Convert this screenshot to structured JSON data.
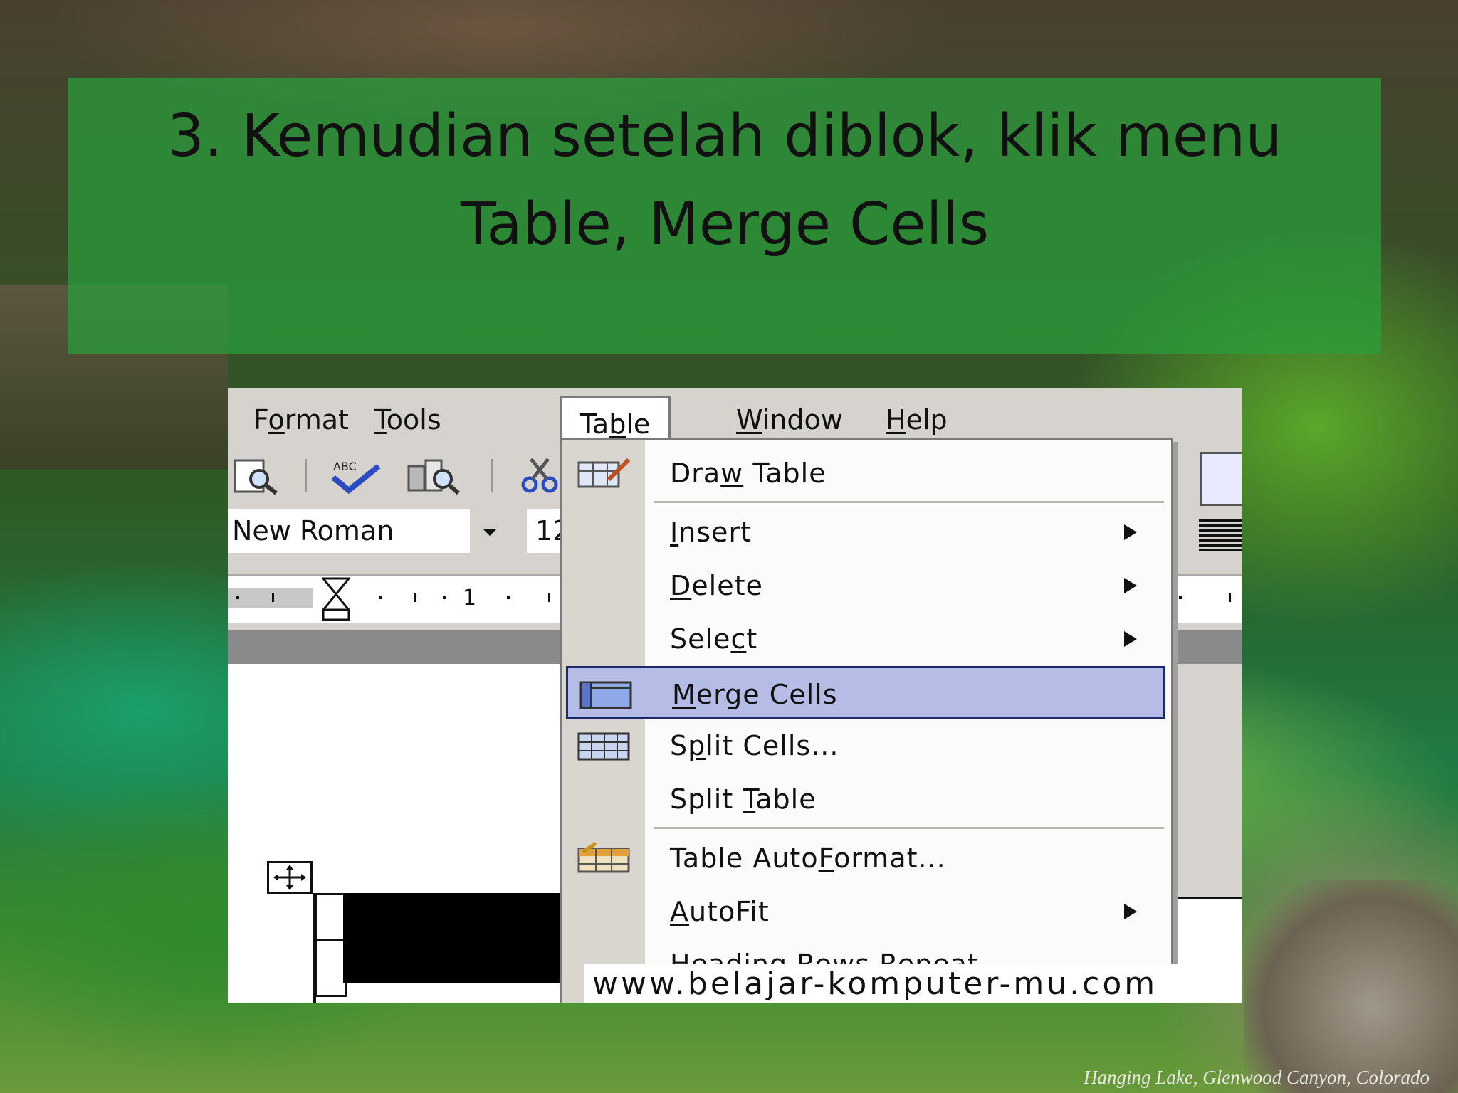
{
  "slide": {
    "title_line1": "3. Kemudian setelah diblok, klik menu",
    "title_line2": "Table, Merge Cells",
    "photo_credit": "Hanging Lake, Glenwood Canyon, Colorado"
  },
  "menubar": {
    "items": [
      {
        "pre": "F",
        "u": "o",
        "post": "rmat"
      },
      {
        "pre": "",
        "u": "T",
        "post": "ools"
      },
      {
        "pre": "Ta",
        "u": "b",
        "post": "le"
      },
      {
        "pre": "",
        "u": "W",
        "post": "indow"
      },
      {
        "pre": "",
        "u": "H",
        "post": "elp"
      }
    ]
  },
  "formatting": {
    "font_name": "New Roman",
    "font_size": "12"
  },
  "ruler": {
    "marker": "1"
  },
  "table_menu": {
    "items": [
      {
        "pre": "Dra",
        "u": "w",
        "post": " Table",
        "icon": "draw-table-icon"
      },
      {
        "pre": "",
        "u": "I",
        "post": "nsert",
        "submenu": true
      },
      {
        "pre": "",
        "u": "D",
        "post": "elete",
        "submenu": true
      },
      {
        "pre": "Sele",
        "u": "c",
        "post": "t",
        "submenu": true
      },
      {
        "pre": "",
        "u": "M",
        "post": "erge Cells",
        "icon": "merge-cells-icon",
        "highlighted": true
      },
      {
        "pre": "S",
        "u": "p",
        "post": "lit Cells...",
        "icon": "split-cells-icon"
      },
      {
        "pre": "Split ",
        "u": "T",
        "post": "able"
      },
      {
        "pre": "Table Auto",
        "u": "F",
        "post": "ormat...",
        "icon": "autoformat-icon"
      },
      {
        "pre": "",
        "u": "A",
        "post": "utoFit",
        "submenu": true
      },
      {
        "pre": "Heading Rows Repeat",
        "u": "",
        "post": ""
      }
    ]
  },
  "watermark": "www.belajar-komputer-mu.com",
  "colors": {
    "title_band": "#28a03c",
    "menu_highlight": "#b5bde6",
    "menu_highlight_border": "#1d2a6a",
    "chrome": "#d6d3ce"
  }
}
